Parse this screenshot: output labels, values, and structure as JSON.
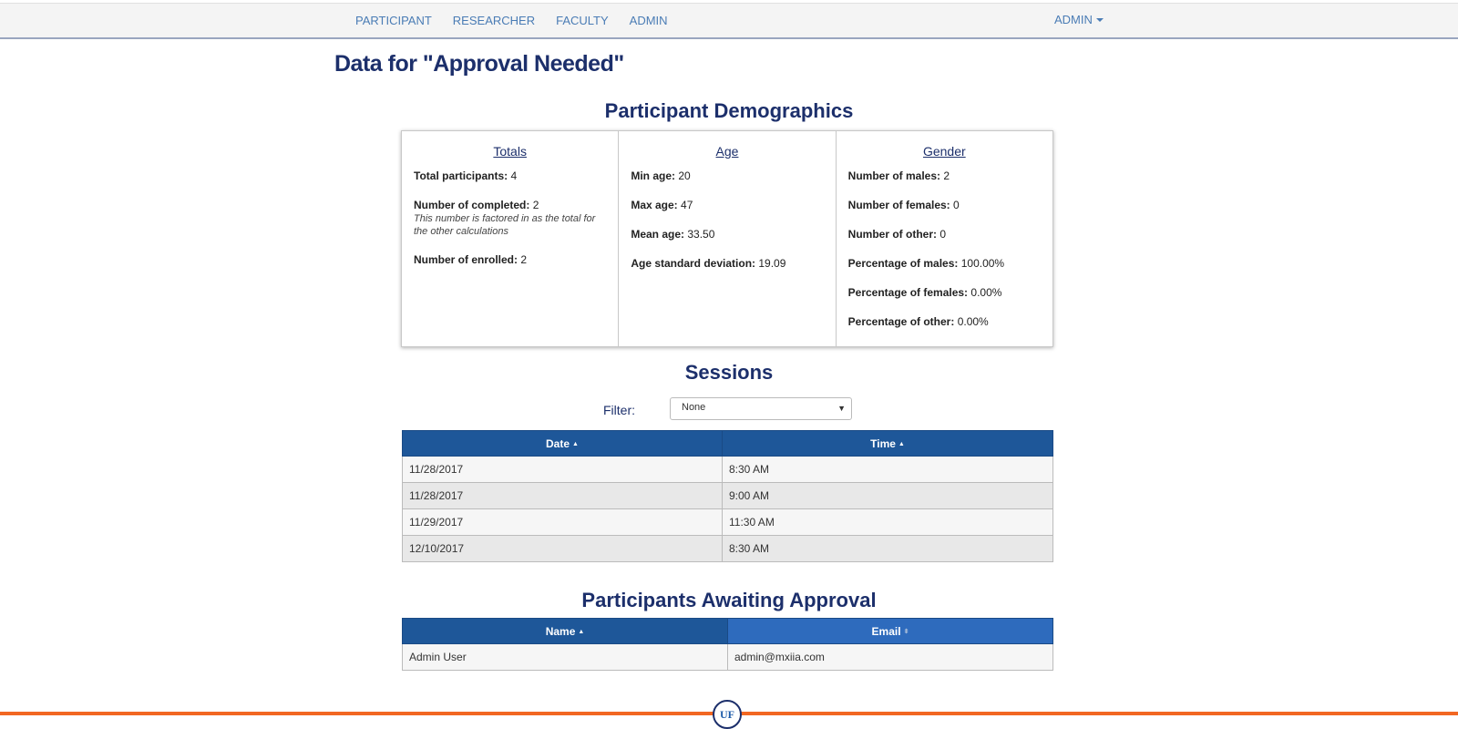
{
  "nav": {
    "links": [
      "PARTICIPANT",
      "RESEARCHER",
      "FACULTY",
      "ADMIN"
    ],
    "user_menu": "ADMIN"
  },
  "page_title": "Data for \"Approval Needed\"",
  "demographics": {
    "title": "Participant Demographics",
    "totals": {
      "heading": "Totals",
      "total_participants_label": "Total participants:",
      "total_participants": "4",
      "completed_label": "Number of completed:",
      "completed": "2",
      "completed_note": "This number is factored in as the total for the other calculations",
      "enrolled_label": "Number of enrolled:",
      "enrolled": "2"
    },
    "age": {
      "heading": "Age",
      "min_label": "Min age:",
      "min": "20",
      "max_label": "Max age:",
      "max": "47",
      "mean_label": "Mean age:",
      "mean": "33.50",
      "sd_label": "Age standard deviation:",
      "sd": "19.09"
    },
    "gender": {
      "heading": "Gender",
      "males_label": "Number of males:",
      "males": "2",
      "females_label": "Number of females:",
      "females": "0",
      "other_label": "Number of other:",
      "other": "0",
      "pct_males_label": "Percentage of males:",
      "pct_males": "100.00%",
      "pct_females_label": "Percentage of females:",
      "pct_females": "0.00%",
      "pct_other_label": "Percentage of other:",
      "pct_other": "0.00%"
    }
  },
  "sessions": {
    "title": "Sessions",
    "filter_label": "Filter:",
    "filter_value": "None",
    "columns": [
      "Date",
      "Time"
    ],
    "rows": [
      [
        "11/28/2017",
        "8:30 AM"
      ],
      [
        "11/28/2017",
        "9:00 AM"
      ],
      [
        "11/29/2017",
        "11:30 AM"
      ],
      [
        "12/10/2017",
        "8:30 AM"
      ]
    ]
  },
  "awaiting": {
    "title": "Participants Awaiting Approval",
    "columns": [
      "Name",
      "Email"
    ],
    "rows": [
      [
        "Admin User",
        "admin@mxiia.com"
      ]
    ]
  },
  "footer": {
    "logo_text": "UF"
  },
  "colors": {
    "primary": "#1c2f6b",
    "table_header": "#1e5799",
    "accent": "#f26722"
  }
}
